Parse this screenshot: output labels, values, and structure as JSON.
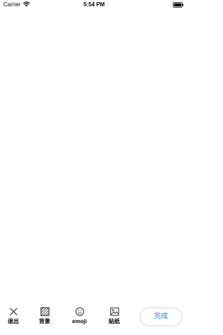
{
  "status_bar": {
    "carrier": "Carrier",
    "time": "5:54 PM"
  },
  "toolbar": {
    "items": [
      {
        "label": "退出",
        "icon": "close-icon"
      },
      {
        "label": "背景",
        "icon": "background-pattern-icon"
      },
      {
        "label": "emoji",
        "icon": "smiley-icon"
      },
      {
        "label": "贴纸",
        "icon": "image-icon"
      }
    ],
    "done_label": "完成"
  },
  "colors": {
    "background": "#ffffff",
    "accent": "#2f7ff5"
  }
}
